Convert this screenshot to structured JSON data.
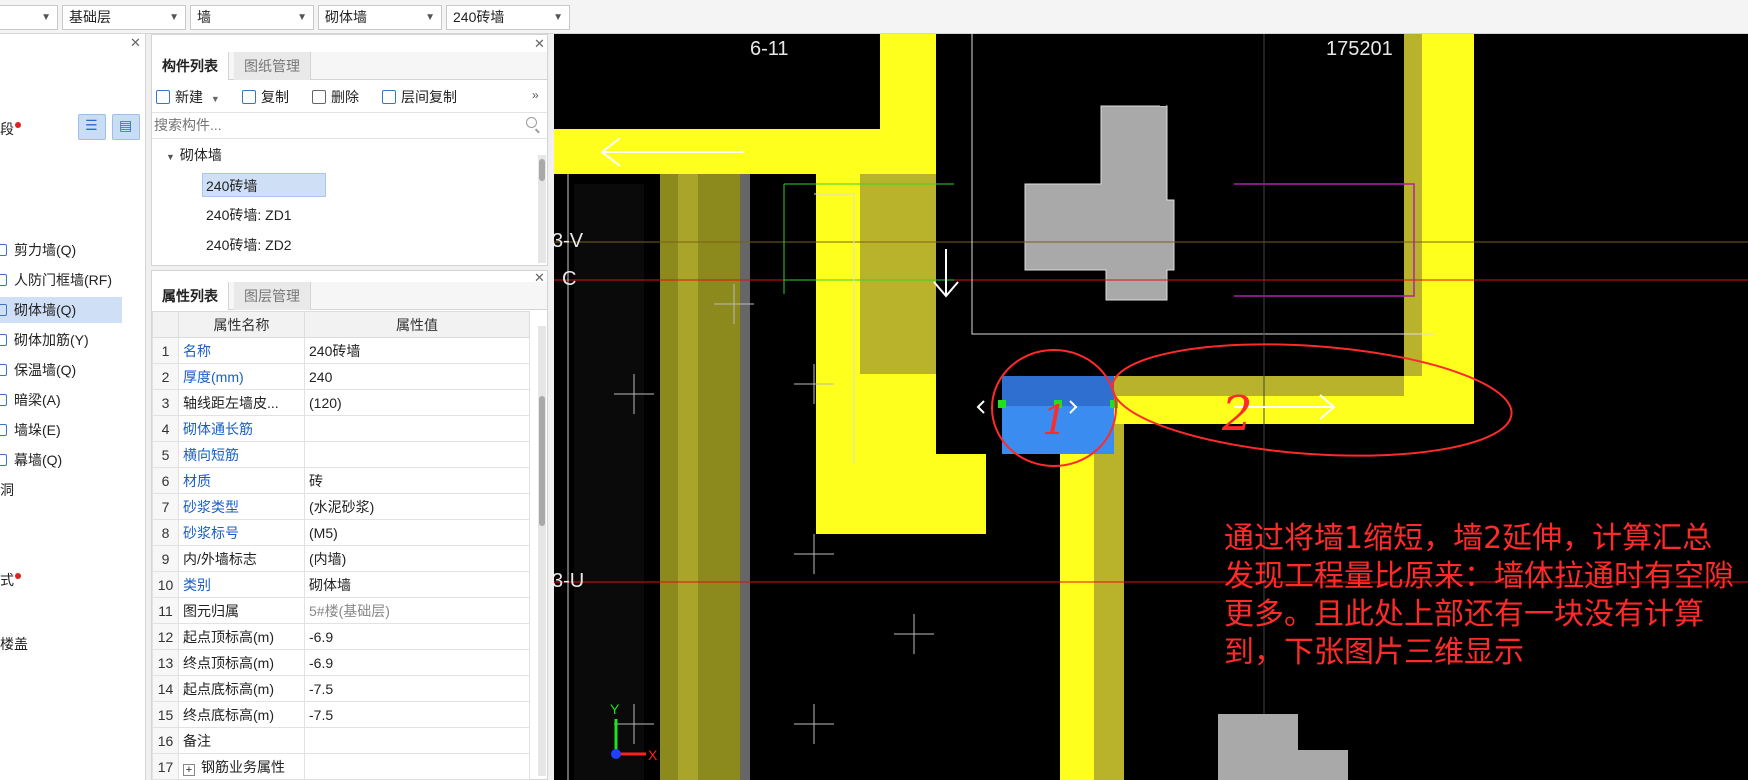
{
  "toolbar": {
    "dropdowns": [
      "",
      "基础层",
      "墙",
      "砌体墙",
      "240砖墙"
    ]
  },
  "nav": {
    "items": [
      {
        "label": "段",
        "dot": true
      },
      {
        "label": "剪力墙(Q)"
      },
      {
        "label": "人防门框墙(RF)"
      },
      {
        "label": "砌体墙(Q)",
        "selected": true
      },
      {
        "label": "砌体加筋(Y)"
      },
      {
        "label": "保温墙(Q)"
      },
      {
        "label": "暗梁(A)"
      },
      {
        "label": "墙垛(E)"
      },
      {
        "label": "幕墙(Q)"
      },
      {
        "label": "洞"
      },
      {
        "label": "式",
        "dot": true
      },
      {
        "label": "楼盖"
      }
    ]
  },
  "component_list": {
    "tabs": [
      "构件列表",
      "图纸管理"
    ],
    "actions": {
      "new": "新建",
      "copy": "复制",
      "delete": "删除",
      "floor_copy": "层间复制"
    },
    "search_placeholder": "搜索构件...",
    "tree": {
      "group": "砌体墙",
      "items": [
        "240砖墙",
        "240砖墙: ZD1",
        "240砖墙: ZD2"
      ]
    }
  },
  "properties": {
    "tabs": [
      "属性列表",
      "图层管理"
    ],
    "headers": {
      "name": "属性名称",
      "value": "属性值"
    },
    "rows": [
      {
        "n": "1",
        "name": "名称",
        "value": "240砖墙",
        "link": true
      },
      {
        "n": "2",
        "name": "厚度(mm)",
        "value": "240",
        "link": true
      },
      {
        "n": "3",
        "name": "轴线距左墙皮...",
        "value": "(120)"
      },
      {
        "n": "4",
        "name": "砌体通长筋",
        "value": "",
        "link": true
      },
      {
        "n": "5",
        "name": "横向短筋",
        "value": "",
        "link": true
      },
      {
        "n": "6",
        "name": "材质",
        "value": "砖",
        "link": true
      },
      {
        "n": "7",
        "name": "砂浆类型",
        "value": "(水泥砂浆)",
        "link": true
      },
      {
        "n": "8",
        "name": "砂浆标号",
        "value": "(M5)",
        "link": true
      },
      {
        "n": "9",
        "name": "内/外墙标志",
        "value": "(内墙)"
      },
      {
        "n": "10",
        "name": "类别",
        "value": "砌体墙",
        "link": true
      },
      {
        "n": "11",
        "name": "图元归属",
        "value": "5#楼(基础层)",
        "gray": true
      },
      {
        "n": "12",
        "name": "起点顶标高(m)",
        "value": "-6.9"
      },
      {
        "n": "13",
        "name": "终点顶标高(m)",
        "value": "-6.9"
      },
      {
        "n": "14",
        "name": "起点底标高(m)",
        "value": "-7.5"
      },
      {
        "n": "15",
        "name": "终点底标高(m)",
        "value": "-7.5"
      },
      {
        "n": "16",
        "name": "备注",
        "value": ""
      },
      {
        "n": "17",
        "name": "钢筋业务属性",
        "value": "",
        "expand": true
      }
    ]
  },
  "canvas": {
    "axis_labels": {
      "top_left": "6-11",
      "top_right": "175201",
      "left_3v": "3-V",
      "left_c": "C",
      "left_3u": "3-U"
    },
    "markers": {
      "one": "1",
      "two": "2"
    },
    "ucs": {
      "x": "X",
      "y": "Y"
    },
    "annotation": "通过将墙1缩短，墙2延伸，计算汇总发现工程量比原来：墙体拉通时有空隙更多。且此处上部还有一块没有计算到，下张图片三维显示",
    "colors": {
      "wall_yellow": "#ffff1e",
      "wall_olive": "#b8b32a",
      "selection_blue": "#3a8cf0",
      "red_ink": "#ff2a2a"
    }
  }
}
